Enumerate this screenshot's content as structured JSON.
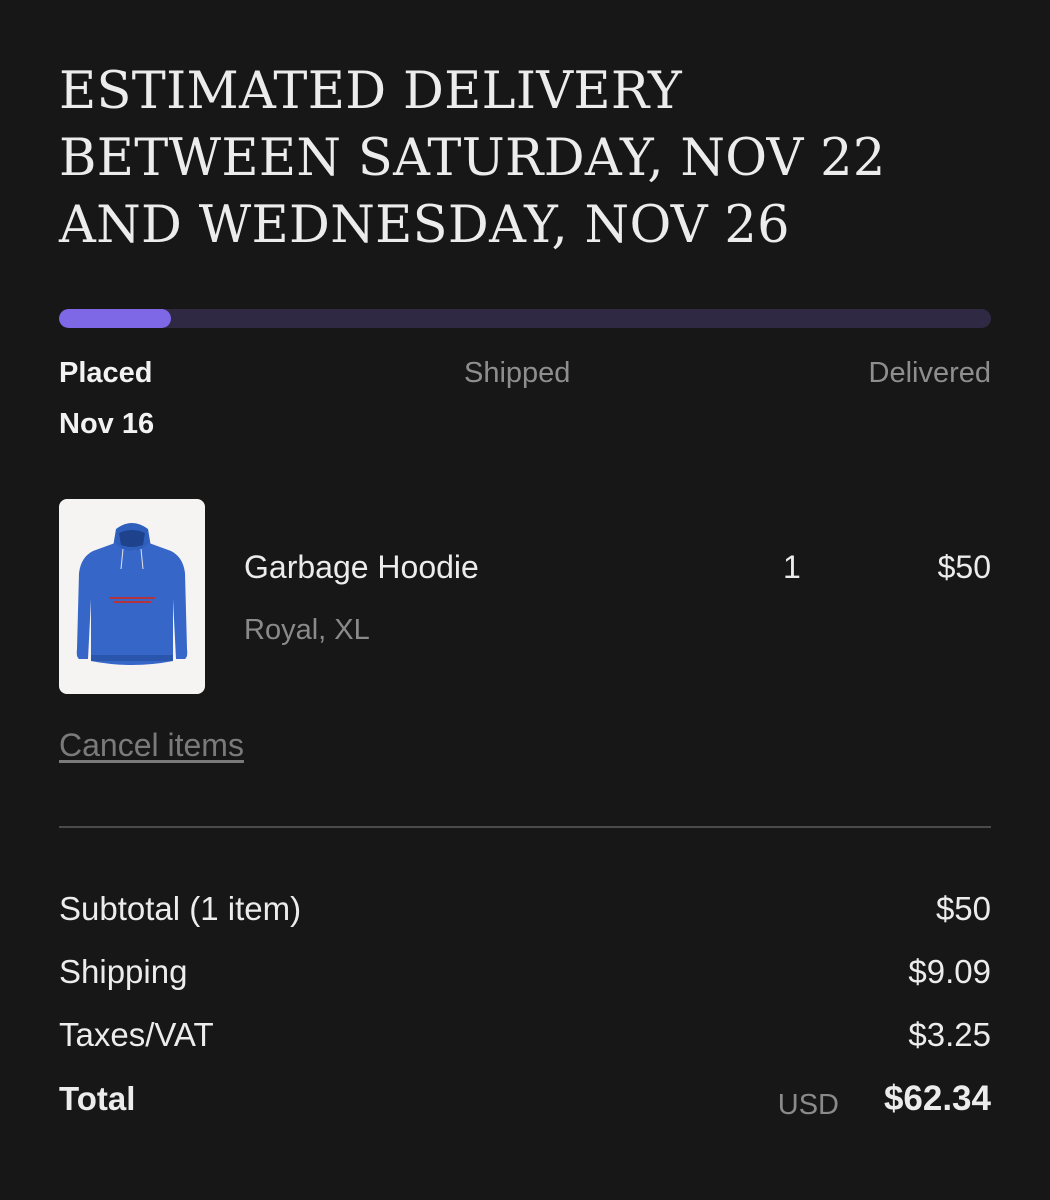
{
  "delivery": {
    "headline": "ESTIMATED DELIVERY BETWEEN SATURDAY, NOV 22 AND WEDNESDAY, NOV 26"
  },
  "progress": {
    "fraction": 0.12,
    "fill_color": "#7e68e6",
    "track_color": "#2f2944",
    "steps": [
      {
        "label": "Placed",
        "date": "Nov 16"
      },
      {
        "label": "Shipped"
      },
      {
        "label": "Delivered"
      }
    ]
  },
  "item": {
    "image_icon": "blue-hoodie-product-image",
    "name": "Garbage Hoodie",
    "variant": "Royal, XL",
    "quantity": "1",
    "price": "$50"
  },
  "actions": {
    "cancel_label": "Cancel items"
  },
  "summary": {
    "subtotal_label": "Subtotal (1 item)",
    "subtotal_value": "$50",
    "shipping_label": "Shipping",
    "shipping_value": "$9.09",
    "taxes_label": "Taxes/VAT",
    "taxes_value": "$3.25",
    "total_label": "Total",
    "total_currency": "USD",
    "total_value": "$62.34"
  }
}
